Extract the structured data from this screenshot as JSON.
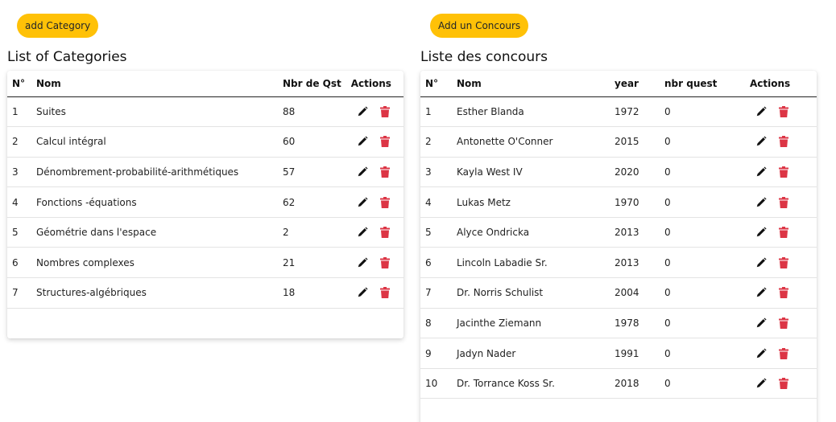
{
  "categories": {
    "add_label": "add Category",
    "title": "List of Categories",
    "headers": [
      "N°",
      "Nom",
      "Nbr de Qst",
      "Actions"
    ],
    "rows": [
      {
        "n": "1",
        "nom": "Suites",
        "nbr": "88"
      },
      {
        "n": "2",
        "nom": "Calcul intégral",
        "nbr": "60"
      },
      {
        "n": "3",
        "nom": "Dénombrement-probabilité-arithmétiques",
        "nbr": "57"
      },
      {
        "n": "4",
        "nom": "Fonctions -équations",
        "nbr": "62"
      },
      {
        "n": "5",
        "nom": "Géométrie dans l'espace",
        "nbr": "2"
      },
      {
        "n": "6",
        "nom": "Nombres complexes",
        "nbr": "21"
      },
      {
        "n": "7",
        "nom": "Structures-algébriques",
        "nbr": "18"
      }
    ]
  },
  "concours": {
    "add_label": "Add un Concours",
    "title": "Liste des concours",
    "headers": [
      "N°",
      "Nom",
      "year",
      "nbr quest",
      "Actions"
    ],
    "rows": [
      {
        "n": "1",
        "nom": "Esther Blanda",
        "year": "1972",
        "nbr": "0"
      },
      {
        "n": "2",
        "nom": "Antonette O'Conner",
        "year": "2015",
        "nbr": "0"
      },
      {
        "n": "3",
        "nom": "Kayla West IV",
        "year": "2020",
        "nbr": "0"
      },
      {
        "n": "4",
        "nom": "Lukas Metz",
        "year": "1970",
        "nbr": "0"
      },
      {
        "n": "5",
        "nom": "Alyce Ondricka",
        "year": "2013",
        "nbr": "0"
      },
      {
        "n": "6",
        "nom": "Lincoln Labadie Sr.",
        "year": "2013",
        "nbr": "0"
      },
      {
        "n": "7",
        "nom": "Dr. Norris Schulist",
        "year": "2004",
        "nbr": "0"
      },
      {
        "n": "8",
        "nom": "Jacinthe Ziemann",
        "year": "1978",
        "nbr": "0"
      },
      {
        "n": "9",
        "nom": "Jadyn Nader",
        "year": "1991",
        "nbr": "0"
      },
      {
        "n": "10",
        "nom": "Dr. Torrance Koss Sr.",
        "year": "2018",
        "nbr": "0"
      }
    ]
  },
  "colors": {
    "accent": "#ffc107",
    "edit_icon": "#111111",
    "delete_icon": "#dc3545"
  },
  "icons": {
    "edit": "pencil-icon",
    "delete": "trash-icon"
  }
}
